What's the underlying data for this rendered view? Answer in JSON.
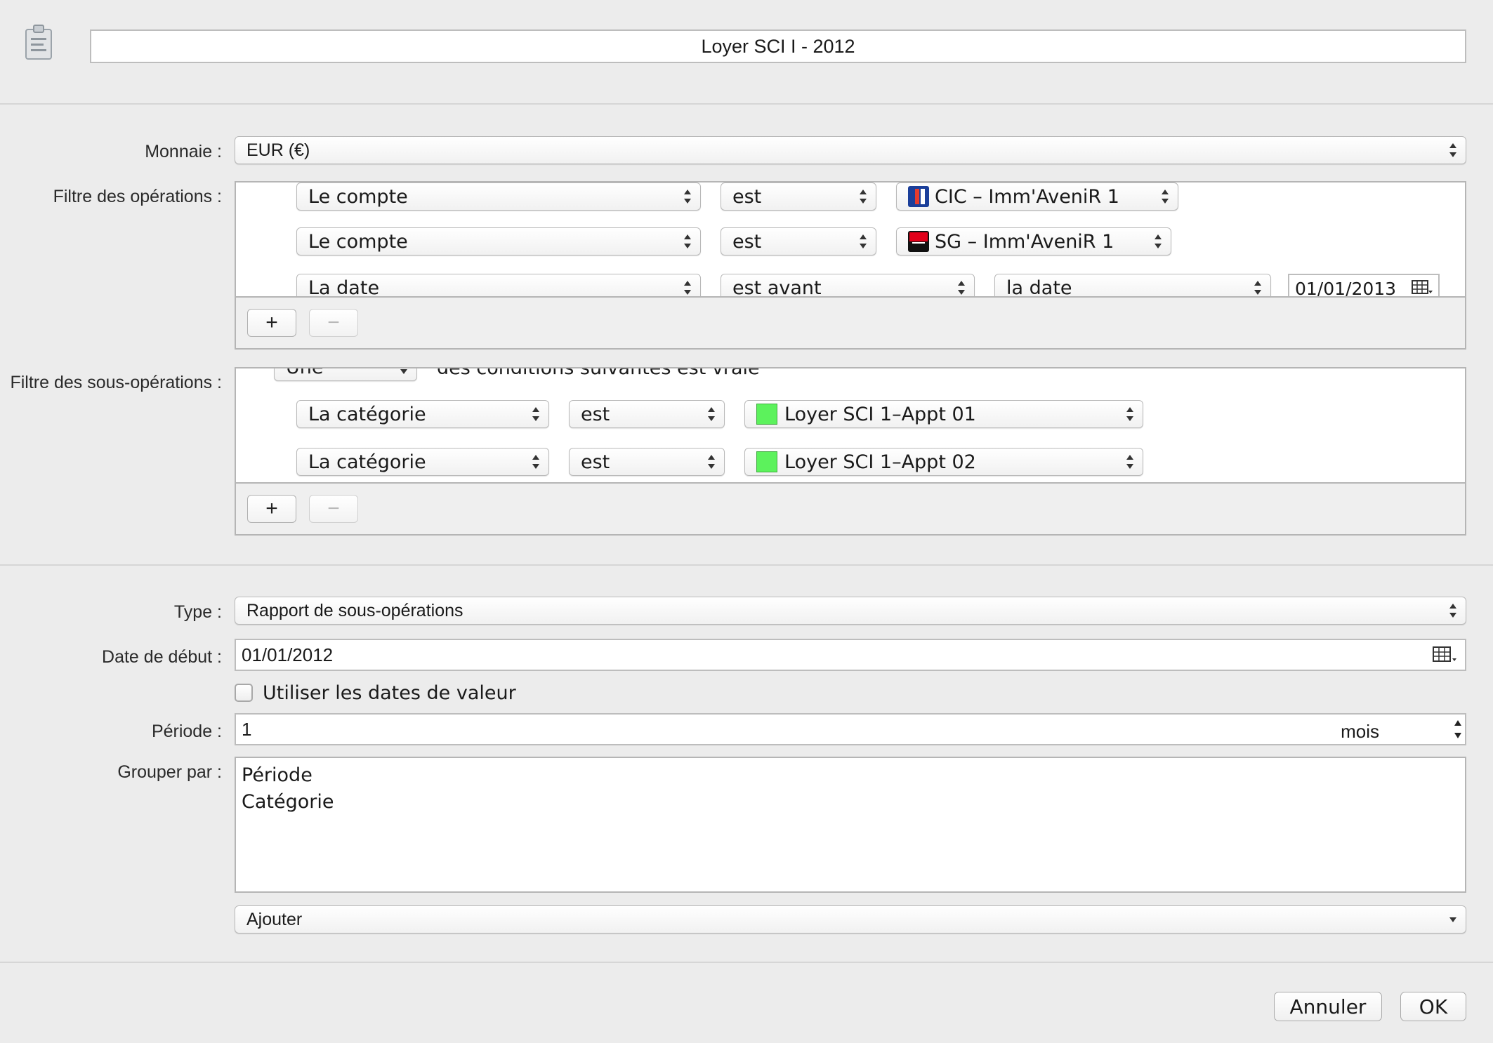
{
  "title": "Loyer SCI I - 2012",
  "currency": {
    "label": "Monnaie :",
    "value": "EUR (€)"
  },
  "op_filter": {
    "label": "Filtre des opérations :",
    "rows": [
      {
        "field": "Le compte",
        "op": "est",
        "value": "CIC – Imm'AveniR 1"
      },
      {
        "field": "Le compte",
        "op": "est",
        "value": "SG – Imm'AveniR 1"
      },
      {
        "field": "La date",
        "op": "est avant",
        "value": "la date",
        "date": "01/01/2013"
      }
    ],
    "add": "+",
    "remove": "−"
  },
  "subop_filter": {
    "label": "Filtre des sous-opérations :",
    "match_select": "Une",
    "match_text": "des conditions suivantes est vraie",
    "rows": [
      {
        "field": "La catégorie",
        "op": "est",
        "value": "Loyer SCI 1–Appt 01"
      },
      {
        "field": "La catégorie",
        "op": "est",
        "value": "Loyer SCI 1–Appt 02"
      }
    ],
    "swatch_color": "#5cf25c",
    "add": "+",
    "remove": "−"
  },
  "type": {
    "label": "Type :",
    "value": "Rapport de sous-opérations"
  },
  "start_date": {
    "label": "Date de début :",
    "value": "01/01/2012"
  },
  "value_dates": {
    "label": "Utiliser les dates de valeur",
    "checked": false
  },
  "period": {
    "label": "Période :",
    "value": "1",
    "unit": "mois"
  },
  "group_by": {
    "label": "Grouper par :",
    "items": [
      "Période",
      "Catégorie"
    ]
  },
  "add_select": {
    "value": "Ajouter"
  },
  "buttons": {
    "cancel": "Annuler",
    "ok": "OK"
  }
}
